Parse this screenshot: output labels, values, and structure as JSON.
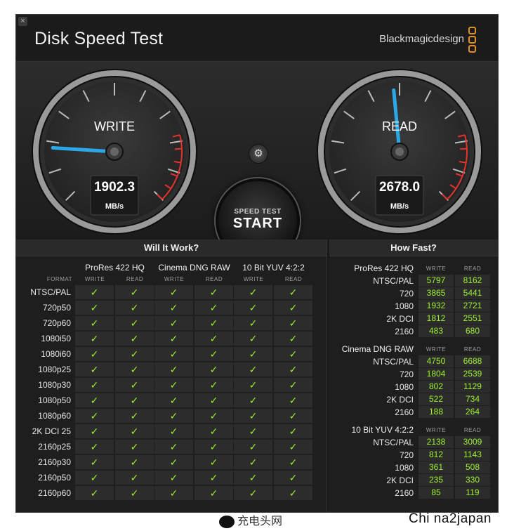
{
  "window": {
    "close": "×"
  },
  "header": {
    "title": "Disk Speed Test",
    "brand": "Blackmagicdesign"
  },
  "write_gauge": {
    "label": "WRITE",
    "value": "1902.3",
    "unit": "MB/s",
    "needle_fraction": 0.18
  },
  "read_gauge": {
    "label": "READ",
    "value": "2678.0",
    "unit": "MB/s",
    "needle_fraction": 0.48
  },
  "settings": {
    "icon": "⚙"
  },
  "start_button": {
    "sub": "SPEED TEST",
    "main": "START"
  },
  "will_it_work": {
    "title": "Will It Work?",
    "format_label": "FORMAT",
    "write_label": "WRITE",
    "read_label": "READ",
    "codecs": [
      "ProRes 422 HQ",
      "Cinema DNG RAW",
      "10 Bit YUV 4:2:2"
    ],
    "check": "✓",
    "formats": [
      "NTSC/PAL",
      "720p50",
      "720p60",
      "1080i50",
      "1080i60",
      "1080p25",
      "1080p30",
      "1080p50",
      "1080p60",
      "2K DCI 25",
      "2160p25",
      "2160p30",
      "2160p50",
      "2160p60"
    ]
  },
  "how_fast": {
    "title": "How Fast?",
    "write_label": "WRITE",
    "read_label": "READ",
    "groups": [
      {
        "name": "ProRes 422 HQ",
        "rows": [
          {
            "label": "NTSC/PAL",
            "write": "5797",
            "read": "8162"
          },
          {
            "label": "720",
            "write": "3865",
            "read": "5441"
          },
          {
            "label": "1080",
            "write": "1932",
            "read": "2721"
          },
          {
            "label": "2K DCI",
            "write": "1812",
            "read": "2551"
          },
          {
            "label": "2160",
            "write": "483",
            "read": "680"
          }
        ]
      },
      {
        "name": "Cinema DNG RAW",
        "rows": [
          {
            "label": "NTSC/PAL",
            "write": "4750",
            "read": "6688"
          },
          {
            "label": "720",
            "write": "1804",
            "read": "2539"
          },
          {
            "label": "1080",
            "write": "802",
            "read": "1129"
          },
          {
            "label": "2K DCI",
            "write": "522",
            "read": "734"
          },
          {
            "label": "2160",
            "write": "188",
            "read": "264"
          }
        ]
      },
      {
        "name": "10 Bit YUV 4:2:2",
        "rows": [
          {
            "label": "NTSC/PAL",
            "write": "2138",
            "read": "3009"
          },
          {
            "label": "720",
            "write": "812",
            "read": "1143"
          },
          {
            "label": "1080",
            "write": "361",
            "read": "508"
          },
          {
            "label": "2K DCI",
            "write": "235",
            "read": "330"
          },
          {
            "label": "2160",
            "write": "85",
            "read": "119"
          }
        ]
      }
    ]
  },
  "watermark": {
    "left": "充电头网",
    "right": "Chi na2japan"
  },
  "colors": {
    "accent_needle": "#2aa8e8",
    "check": "#9df031",
    "redline": "#e0342c",
    "brand_orange": "#e0902a"
  }
}
